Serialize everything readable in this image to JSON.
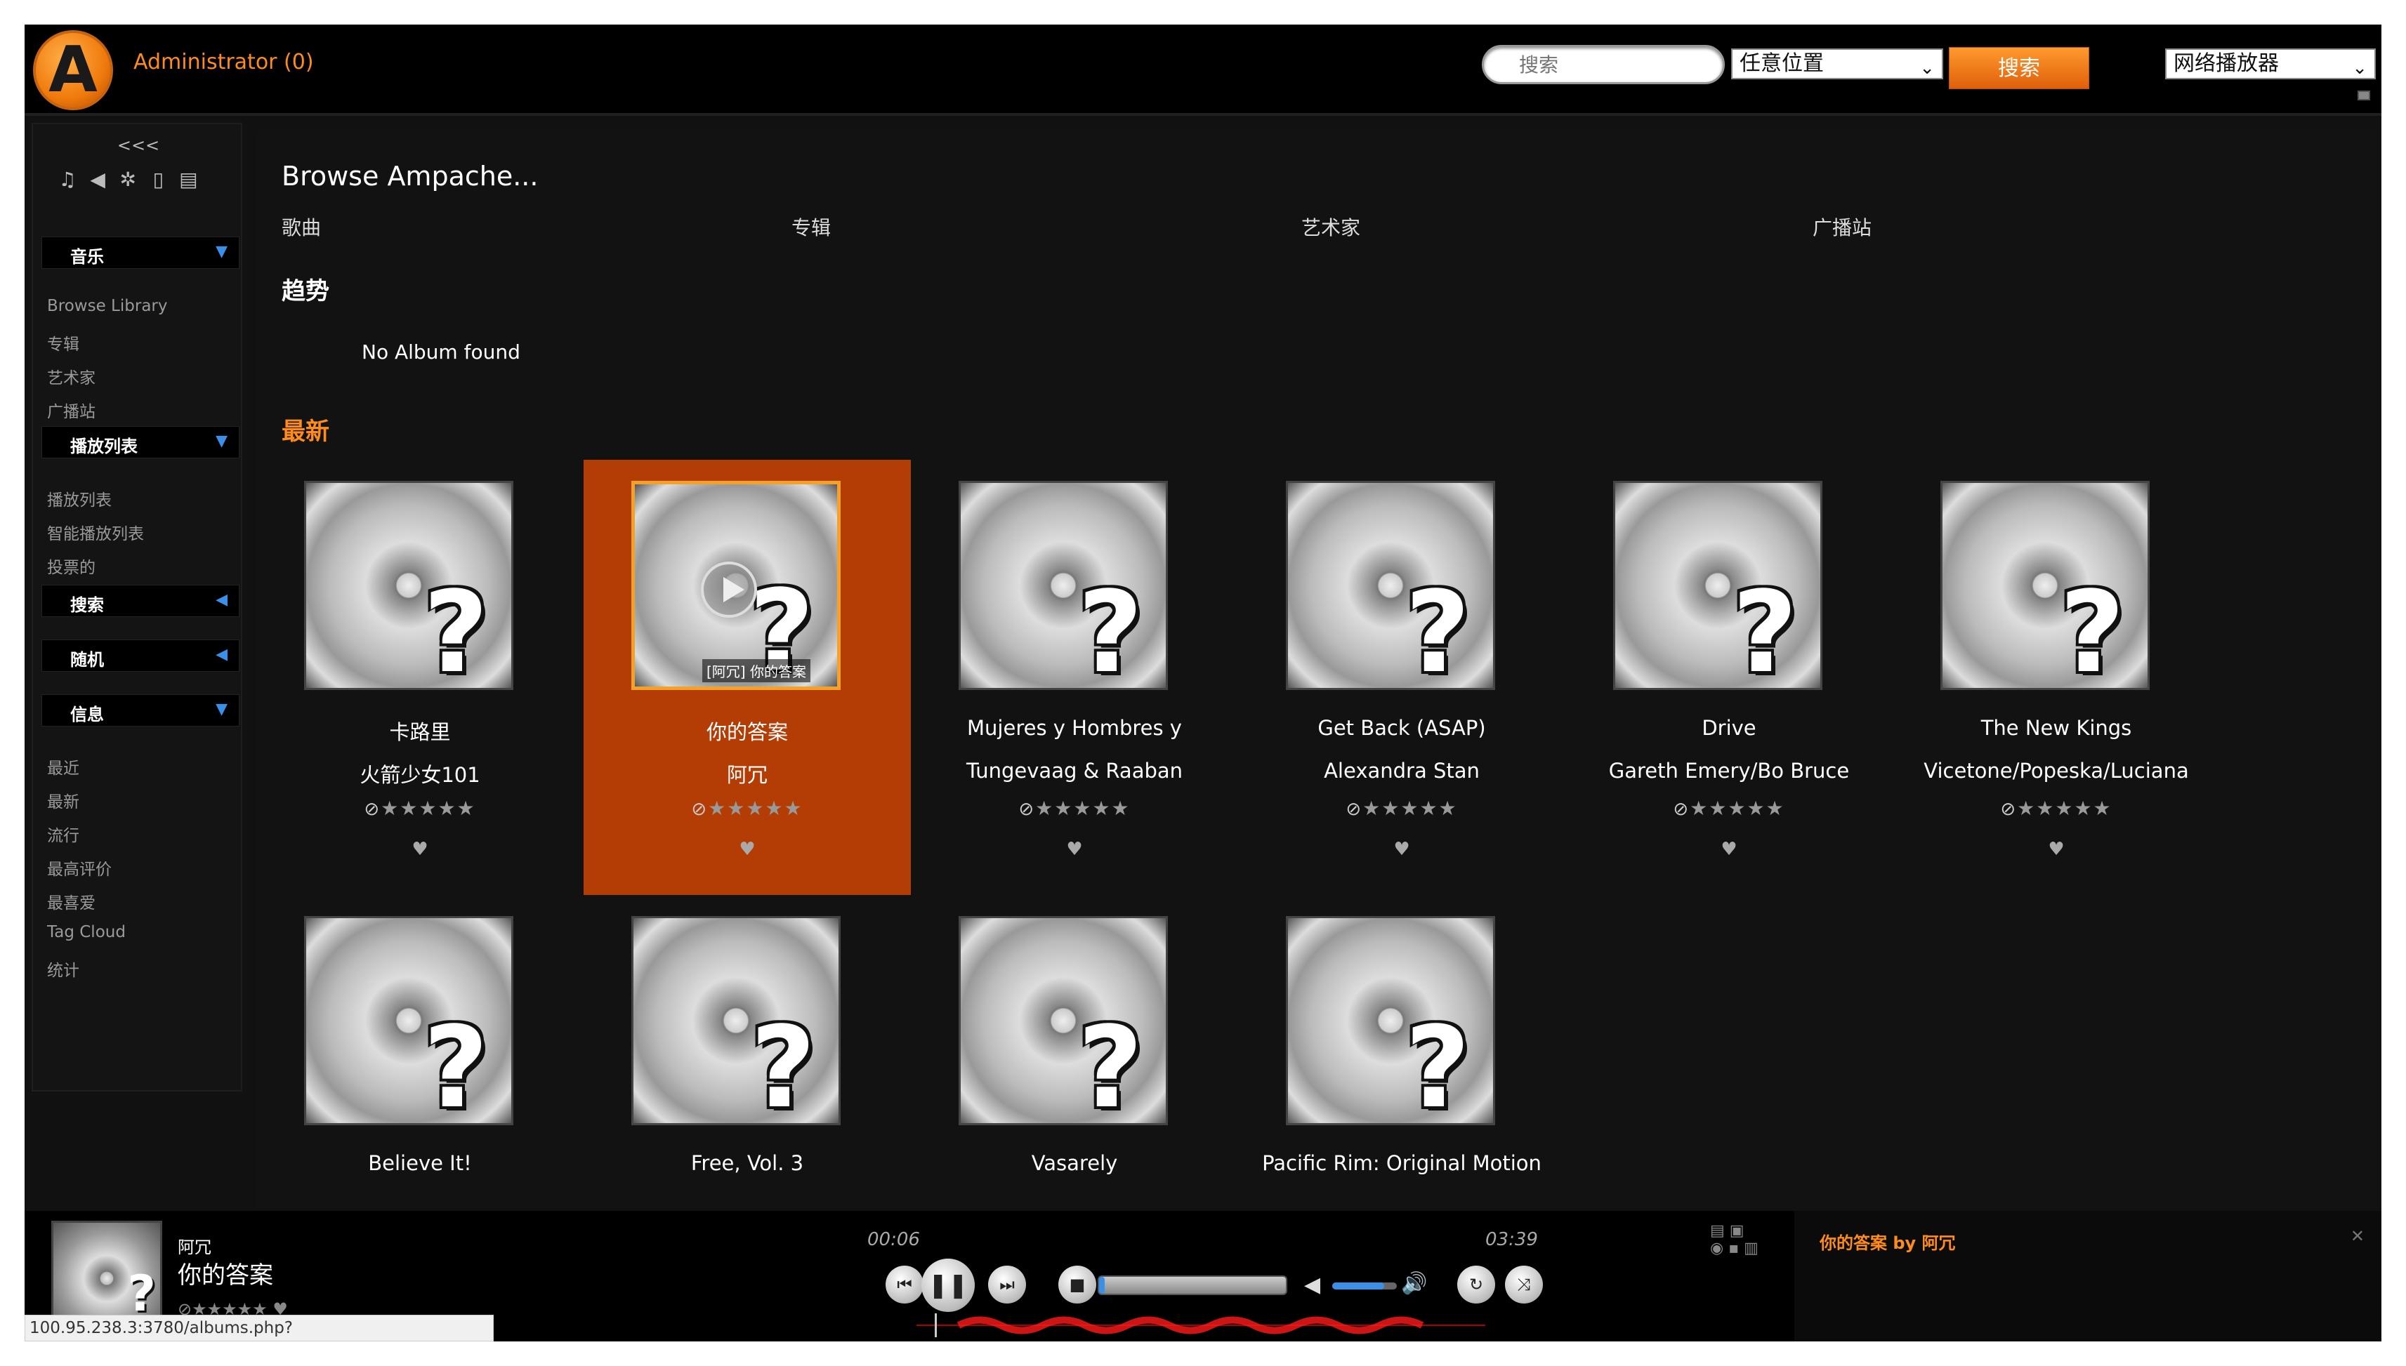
{
  "header": {
    "user": "Administrator (0)",
    "search_placeholder": "搜索",
    "search_scope": "任意位置",
    "search_button": "搜索",
    "player_type": "网络播放器"
  },
  "sidebar": {
    "collapse": "<<<",
    "sections": {
      "music": "音乐",
      "playlists": "播放列表",
      "search": "搜索",
      "random": "随机",
      "info": "信息"
    },
    "music_items": [
      "Browse Library",
      "专辑",
      "艺术家",
      "广播站"
    ],
    "playlist_items": [
      "播放列表",
      "智能播放列表",
      "投票的"
    ],
    "info_items": [
      "最近",
      "最新",
      "流行",
      "最高评价",
      "最喜爱",
      "Tag Cloud",
      "统计"
    ]
  },
  "main": {
    "browse_title": "Browse Ampache...",
    "browse_links": [
      "歌曲",
      "专辑",
      "艺术家",
      "广播站"
    ],
    "trending_title": "趋势",
    "no_album": "No Album found",
    "newest_title": "最新",
    "hover_caption": "[阿冗] 你的答案",
    "albums": [
      {
        "title": "卡路里",
        "artist": "火箭少女101"
      },
      {
        "title": "你的答案",
        "artist": "阿冗"
      },
      {
        "title": "Mujeres y Hombres y",
        "artist": "Tungevaag & Raaban"
      },
      {
        "title": "Get Back (ASAP)",
        "artist": "Alexandra Stan"
      },
      {
        "title": "Drive",
        "artist": "Gareth Emery/Bo Bruce"
      },
      {
        "title": "The New Kings",
        "artist": "Vicetone/Popeska/Luciana"
      },
      {
        "title": "Believe It!",
        "artist": ""
      },
      {
        "title": "Free, Vol. 3",
        "artist": ""
      },
      {
        "title": "Vasarely",
        "artist": ""
      },
      {
        "title": "Pacific Rim: Original Motion",
        "artist": ""
      }
    ]
  },
  "player": {
    "artist": "阿冗",
    "title": "你的答案",
    "url": "100.95.238.3:3780/albums.php?action=show&album=78",
    "elapsed": "00:06",
    "total": "03:39",
    "progress": 0.03,
    "volume": 0.8,
    "playlist_entry": "你的答案 by 阿冗"
  },
  "colors": {
    "accent": "#ff8c1a",
    "active_album_bg": "#b33d05",
    "blue": "#3a8fe8"
  }
}
